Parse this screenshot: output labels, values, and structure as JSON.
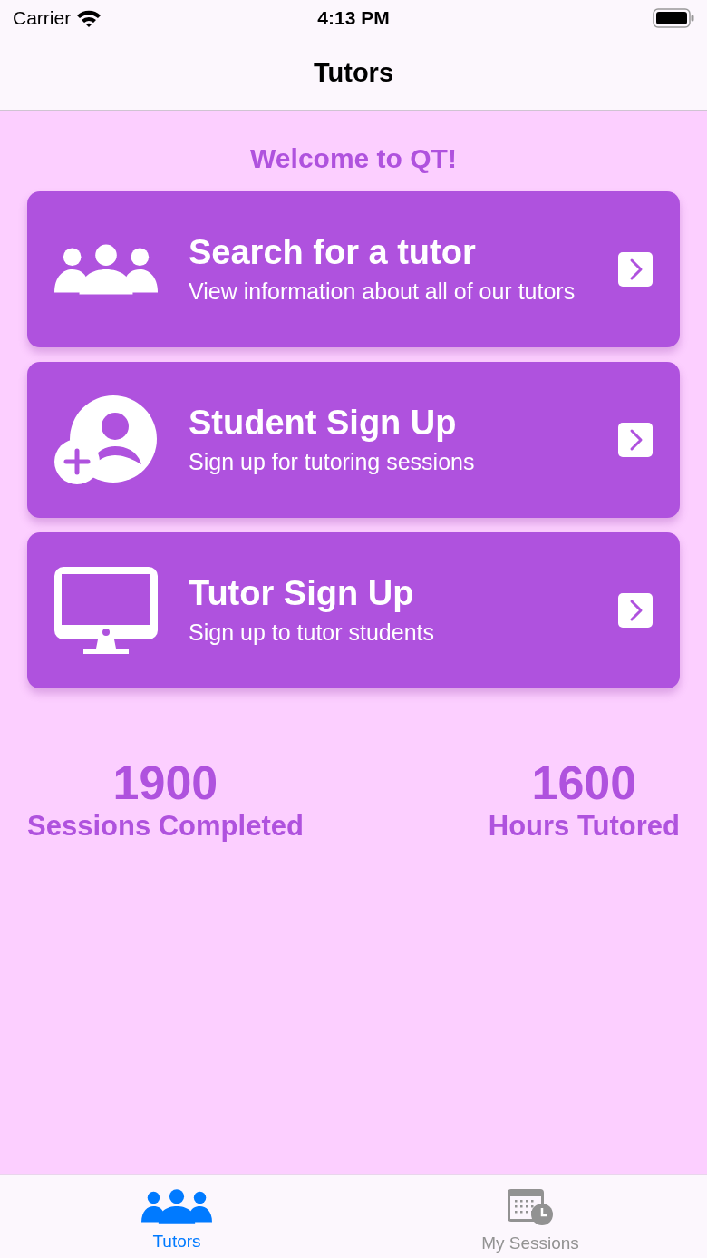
{
  "status_bar": {
    "carrier": "Carrier",
    "time": "4:13 PM"
  },
  "nav": {
    "title": "Tutors"
  },
  "welcome": "Welcome to QT!",
  "cards": [
    {
      "kind": "group",
      "title": "Search for a tutor",
      "subtitle": "View information about all of our tutors"
    },
    {
      "kind": "person-add",
      "title": "Student Sign Up",
      "subtitle": "Sign up for tutoring sessions"
    },
    {
      "kind": "monitor",
      "title": "Tutor Sign Up",
      "subtitle": "Sign up to tutor students"
    }
  ],
  "stats": [
    {
      "value": "1900",
      "label": "Sessions Completed"
    },
    {
      "value": "1600",
      "label": "Hours Tutored"
    }
  ],
  "tabs": [
    {
      "kind": "group",
      "label": "Tutors",
      "selected": true
    },
    {
      "kind": "calendar",
      "label": "My Sessions",
      "selected": false
    }
  ]
}
